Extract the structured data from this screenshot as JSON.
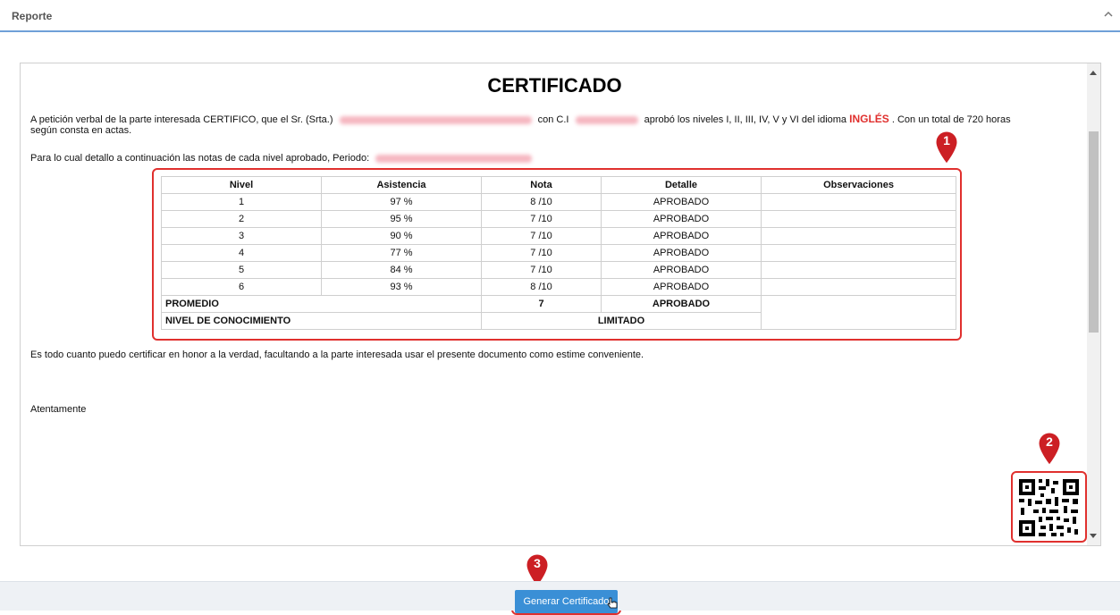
{
  "panel": {
    "title": "Reporte"
  },
  "certificate": {
    "title": "CERTIFICADO",
    "intro_part1": "A petición verbal de la parte interesada CERTIFICO, que el Sr. (Srta.)",
    "intro_con_ci": "con C.I",
    "intro_part2": "aprobó los niveles I, II, III, IV, V y VI del idioma",
    "language": "INGLÉS",
    "intro_part3": ". Con un total de 720 horas",
    "intro_line2": "según consta en actas.",
    "period_text": "Para lo cual detallo a continuación las notas de cada nivel aprobado, Periodo:",
    "closing": "Es todo cuanto puedo certificar en honor a la verdad, facultando a la parte interesada usar el presente documento como estime conveniente.",
    "sign_off": "Atentamente"
  },
  "table": {
    "headers": [
      "Nivel",
      "Asistencia",
      "Nota",
      "Detalle",
      "Observaciones"
    ],
    "rows": [
      [
        "1",
        "97 %",
        "8 /10",
        "APROBADO",
        ""
      ],
      [
        "2",
        "95 %",
        "7 /10",
        "APROBADO",
        ""
      ],
      [
        "3",
        "90 %",
        "7 /10",
        "APROBADO",
        ""
      ],
      [
        "4",
        "77 %",
        "7 /10",
        "APROBADO",
        ""
      ],
      [
        "5",
        "84 %",
        "7 /10",
        "APROBADO",
        ""
      ],
      [
        "6",
        "93 %",
        "8 /10",
        "APROBADO",
        ""
      ]
    ],
    "promedio_label": "PROMEDIO",
    "promedio_value": "7",
    "promedio_detail": "APROBADO",
    "nivel_label": "NIVEL DE CONOCIMIENTO",
    "nivel_value": "LIMITADO"
  },
  "annotations": {
    "one": "1",
    "two": "2",
    "three": "3"
  },
  "actions": {
    "generate_label": "Generar Certificado"
  },
  "colors": {
    "accent": "#3a8fd6",
    "highlight": "#e0302e"
  }
}
